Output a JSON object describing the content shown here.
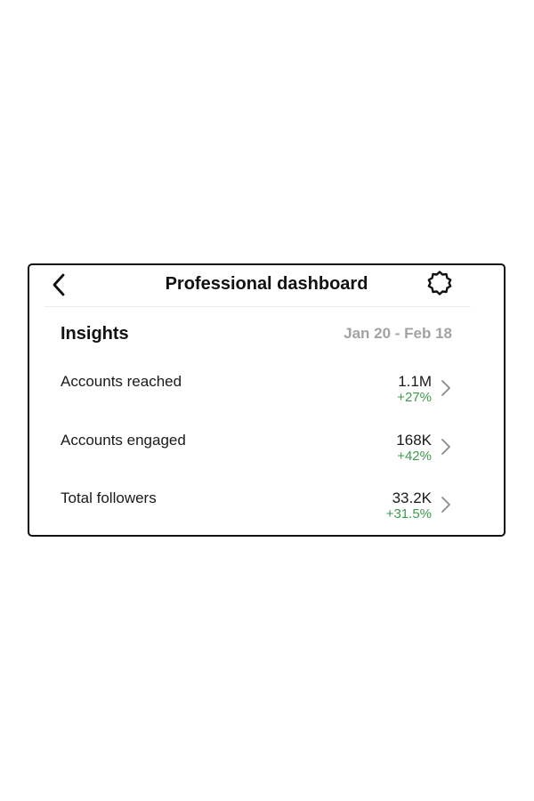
{
  "header": {
    "title": "Professional dashboard",
    "back_icon": "chevron-left-icon",
    "settings_icon": "gear-icon"
  },
  "insights": {
    "title": "Insights",
    "date_range": "Jan 20 - Feb 18",
    "metrics": [
      {
        "label": "Accounts reached",
        "value": "1.1M",
        "change": "+27%"
      },
      {
        "label": "Accounts engaged",
        "value": "168K",
        "change": "+42%"
      },
      {
        "label": "Total followers",
        "value": "33.2K",
        "change": "+31.5%"
      }
    ]
  },
  "colors": {
    "positive_change": "#3d9a4f",
    "muted_text": "#a3a3a3",
    "border": "#111111"
  }
}
